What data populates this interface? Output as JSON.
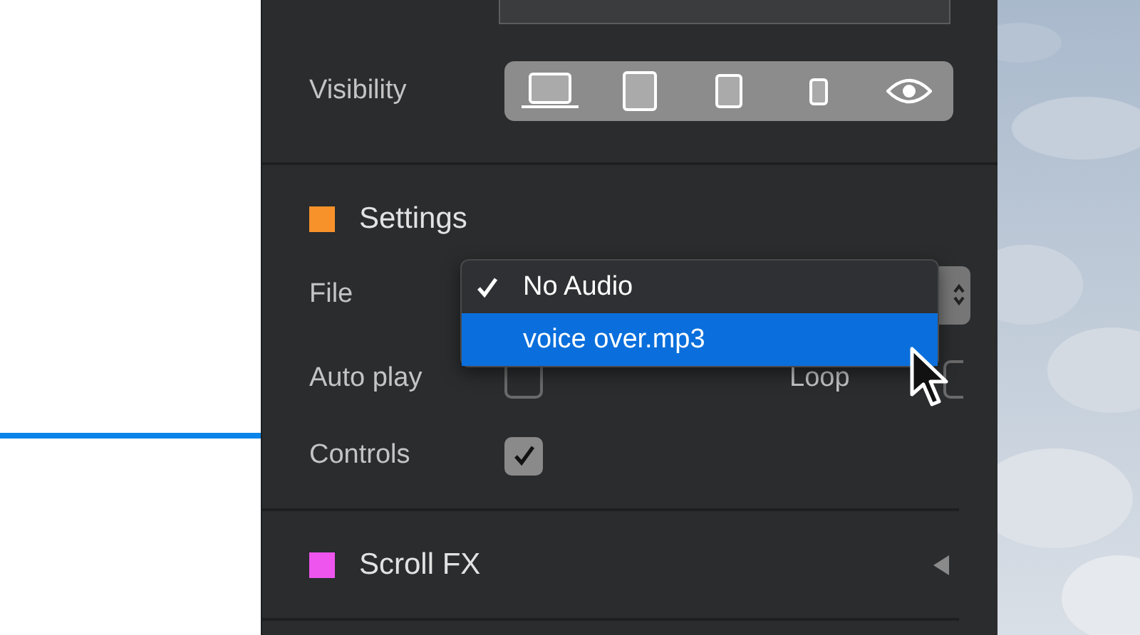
{
  "visibility": {
    "label": "Visibility",
    "options": [
      {
        "kind": "laptop"
      },
      {
        "kind": "tablet"
      },
      {
        "kind": "tablet-small"
      },
      {
        "kind": "phone"
      },
      {
        "kind": "eye"
      }
    ]
  },
  "sections": [
    {
      "title": "Settings",
      "color": "#f7922a",
      "expanded": true,
      "file": {
        "label": "File",
        "menu": [
          {
            "label": "No Audio",
            "checked": true,
            "selected": false
          },
          {
            "label": "voice over.mp3",
            "checked": false,
            "selected": true
          }
        ]
      },
      "options": [
        {
          "label": "Auto play",
          "checked": false
        },
        {
          "label": "Loop",
          "checked": false
        },
        {
          "label": "Controls",
          "checked": true
        }
      ]
    },
    {
      "title": "Scroll FX",
      "color": "#ee55ee",
      "expanded": false
    }
  ]
}
